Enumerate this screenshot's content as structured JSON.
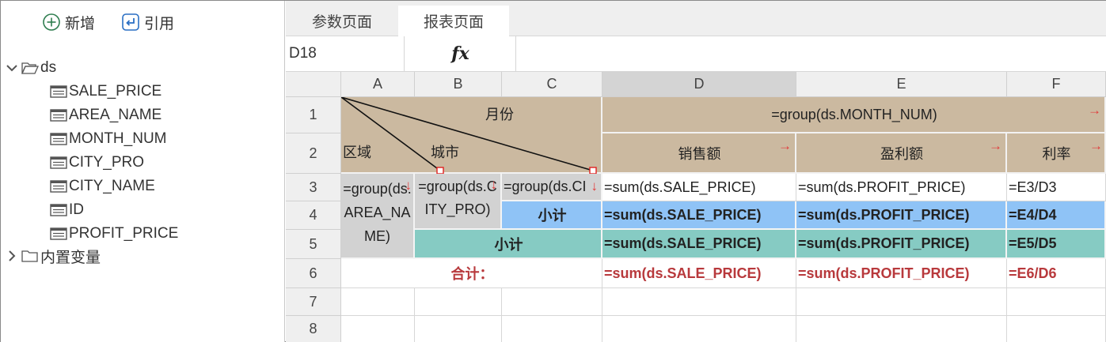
{
  "toolbar": {
    "add_label": "新增",
    "ref_label": "引用"
  },
  "tree": {
    "ds_label": "ds",
    "fields": [
      "SALE_PRICE",
      "AREA_NAME",
      "MONTH_NUM",
      "CITY_PRO",
      "CITY_NAME",
      "ID",
      "PROFIT_PRICE"
    ],
    "builtin_label": "内置变量"
  },
  "tabs": {
    "params": "参数页面",
    "report": "报表页面"
  },
  "formula_bar": {
    "cell_ref": "D18",
    "fx_label": "fx",
    "formula": ""
  },
  "columns": [
    "A",
    "B",
    "C",
    "D",
    "E",
    "F"
  ],
  "rows": [
    "1",
    "2",
    "3",
    "4",
    "5",
    "6",
    "7",
    "8"
  ],
  "cells": {
    "header_month": "月份",
    "header_region": "区域",
    "header_city": "城市",
    "month_group": "=group(ds.MONTH_NUM)",
    "sales": "销售额",
    "profit": "盈利额",
    "rate": "利率",
    "a3": "=group(ds.AREA_NAME)",
    "b3": "=group(ds.CITY_PRO)",
    "c3": "=group(ds.CI",
    "d3": "=sum(ds.SALE_PRICE)",
    "e3": "=sum(ds.PROFIT_PRICE)",
    "f3": "=E3/D3",
    "c4": "小计",
    "d4": "=sum(ds.SALE_PRICE)",
    "e4": "=sum(ds.PROFIT_PRICE)",
    "f4": "=E4/D4",
    "b5": "小计",
    "d5": "=sum(ds.SALE_PRICE)",
    "e5": "=sum(ds.PROFIT_PRICE)",
    "f5": "=E5/D5",
    "a6": "合计：",
    "d6": "=sum(ds.SALE_PRICE)",
    "e6": "=sum(ds.PROFIT_PRICE)",
    "f6": "=E6/D6"
  },
  "colors": {
    "tan": "#cbb9a0",
    "gray": "#d2d2d2",
    "blue": "#8fc3f6",
    "teal": "#86cbc3",
    "red_text": "#b8393c",
    "expand_arrow": "#e23b3b"
  }
}
